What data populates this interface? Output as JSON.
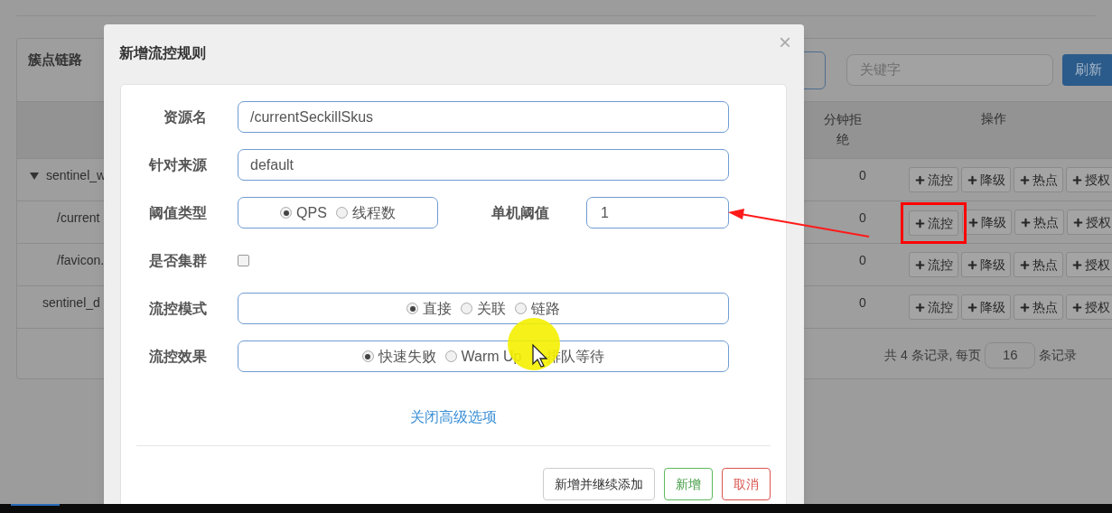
{
  "background": {
    "panel_title": "簇点链路",
    "search": {
      "placeholder": "关键字"
    },
    "refresh_button": "刷新",
    "columns": [
      {
        "label": "分钟拒绝"
      },
      {
        "label": "操作"
      }
    ],
    "rows": [
      {
        "name": "sentinel_w",
        "expanded": true,
        "reject": "0",
        "actions": [
          {
            "label": "流控",
            "highlighted": false
          },
          {
            "label": "降级",
            "highlighted": false
          },
          {
            "label": "热点",
            "highlighted": false
          },
          {
            "label": "授权",
            "highlighted": false
          }
        ],
        "children": [
          {
            "name": "/current",
            "reject": "0",
            "actions": [
              {
                "label": "流控",
                "highlighted": true
              },
              {
                "label": "降级",
                "highlighted": false
              },
              {
                "label": "热点",
                "highlighted": false
              },
              {
                "label": "授权",
                "highlighted": false
              }
            ]
          },
          {
            "name": "/favicon.",
            "reject": "0",
            "actions": [
              {
                "label": "流控",
                "highlighted": false
              },
              {
                "label": "降级",
                "highlighted": false
              },
              {
                "label": "热点",
                "highlighted": false
              },
              {
                "label": "授权",
                "highlighted": false
              }
            ]
          }
        ]
      },
      {
        "name": "sentinel_d",
        "reject": "0",
        "actions": [
          {
            "label": "流控",
            "highlighted": false
          },
          {
            "label": "降级",
            "highlighted": false
          },
          {
            "label": "热点",
            "highlighted": false
          },
          {
            "label": "授权",
            "highlighted": false
          }
        ]
      }
    ],
    "footer": {
      "before": "共 4 条记录, 每页",
      "page_size": "16",
      "after": "条记录"
    }
  },
  "dialog": {
    "title": "新增流控规则",
    "close": "×",
    "fields": [
      {
        "kind": "text",
        "label": "资源名",
        "value": "/currentSeckillSkus"
      },
      {
        "kind": "text",
        "label": "针对来源",
        "value": "default"
      },
      {
        "kind": "radio",
        "label": "阈值类型",
        "options": [
          {
            "label": "QPS",
            "selected": true
          },
          {
            "label": "线程数",
            "selected": false
          }
        ],
        "side": {
          "label": "单机阈值",
          "value": "1"
        }
      },
      {
        "kind": "checkbox",
        "label": "是否集群",
        "checked": false
      },
      {
        "kind": "radio",
        "label": "流控模式",
        "options": [
          {
            "label": "直接",
            "selected": true
          },
          {
            "label": "关联",
            "selected": false
          },
          {
            "label": "链路",
            "selected": false
          }
        ]
      },
      {
        "kind": "radio",
        "label": "流控效果",
        "options": [
          {
            "label": "快速失败",
            "selected": true
          },
          {
            "label": "Warm Up",
            "selected": false
          },
          {
            "label": "排队等待"
          }
        ]
      }
    ],
    "link": "关闭高级选项",
    "buttons": [
      {
        "label": "新增并继续添加",
        "kind": "default"
      },
      {
        "label": "新增",
        "kind": "success"
      },
      {
        "label": "取消",
        "kind": "danger"
      }
    ]
  }
}
